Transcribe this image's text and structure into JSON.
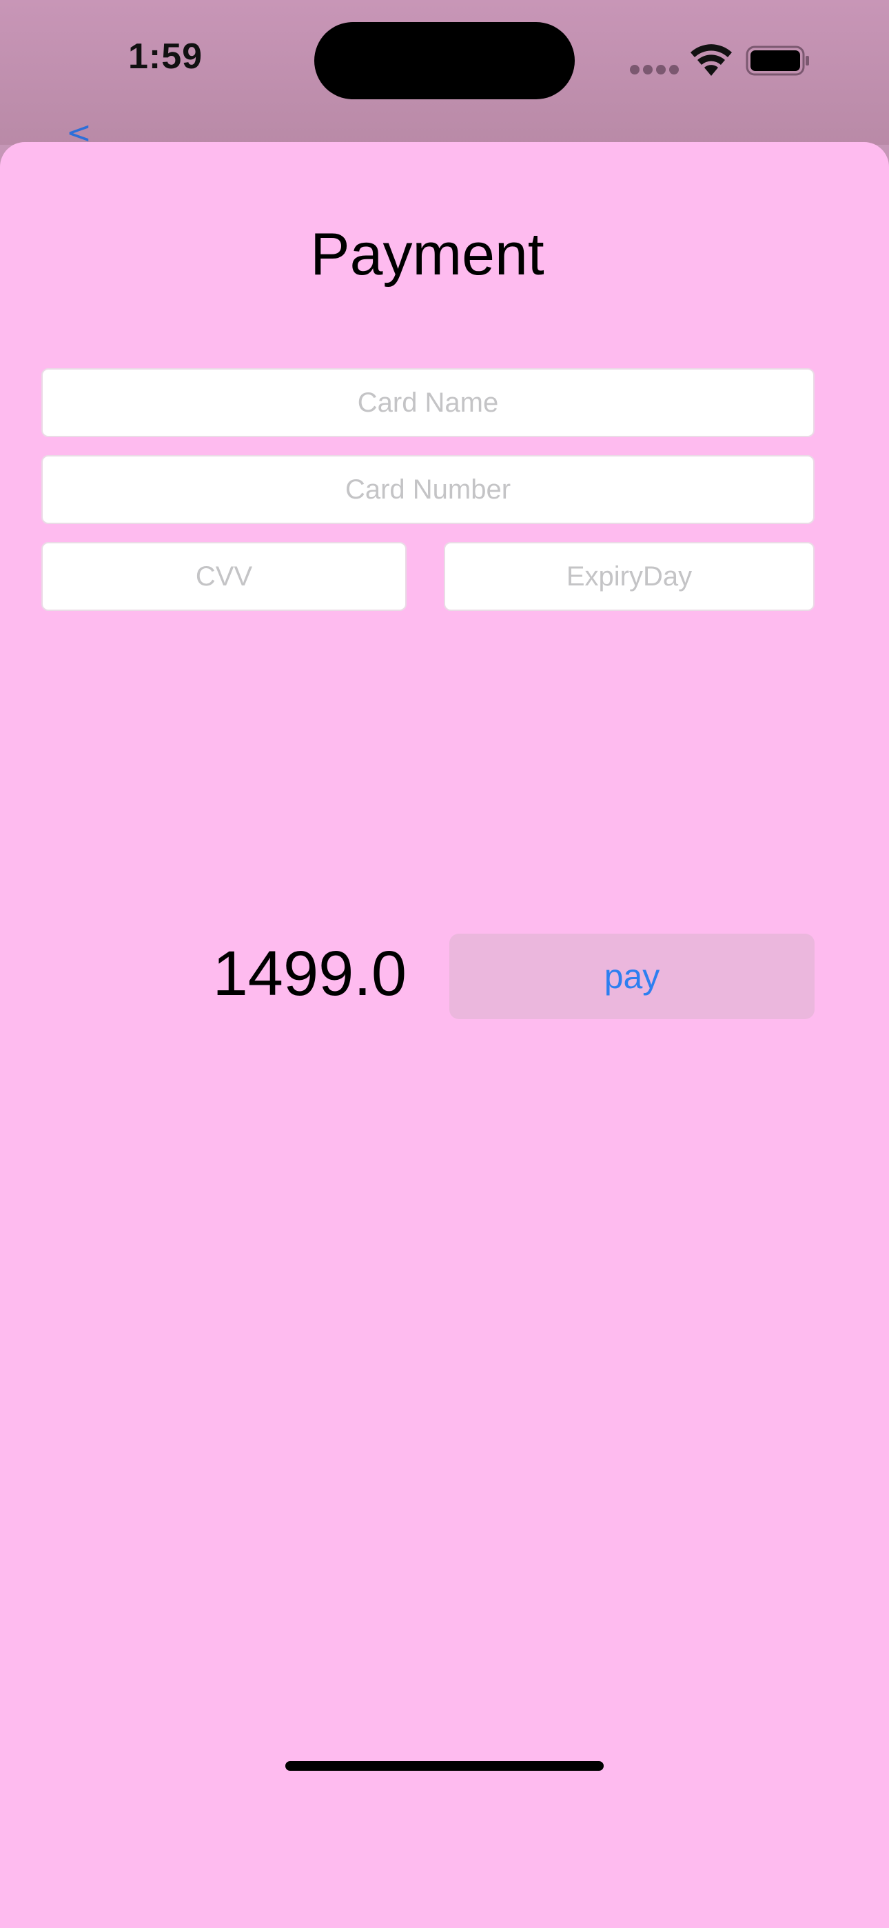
{
  "status_bar": {
    "time": "1:59"
  },
  "nav": {
    "back_label": "<"
  },
  "page": {
    "title": "Payment"
  },
  "form": {
    "card_name": {
      "value": "",
      "placeholder": "Card Name"
    },
    "card_number": {
      "value": "",
      "placeholder": "Card Number"
    },
    "cvv": {
      "value": "",
      "placeholder": "CVV"
    },
    "expiry": {
      "value": "",
      "placeholder": "ExpiryDay"
    }
  },
  "checkout": {
    "amount": "1499.0",
    "pay_label": "pay"
  },
  "colors": {
    "background": "#febbef",
    "pay_button_bg": "#ebb7dd",
    "accent": "#2d7ff0"
  },
  "icons": [
    "wifi-icon",
    "battery-icon",
    "back-chevron-icon"
  ]
}
